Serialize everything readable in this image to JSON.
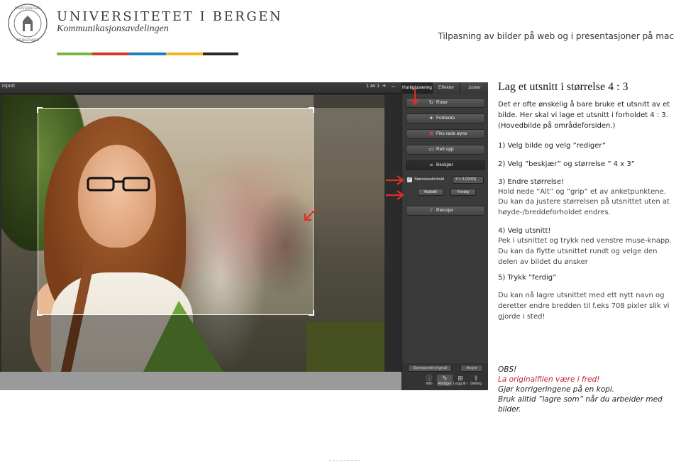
{
  "header": {
    "university": "UNIVERSITETET I BERGEN",
    "department": "Kommunikasjonsavdelingen",
    "title": "Tilpasning av bilder på web og i presentasjoner på mac",
    "stripe_colors": [
      "#7cb342",
      "#d23a2c",
      "#1e7fbf",
      "#f2b51c",
      "#2a2a2a"
    ]
  },
  "screenshot": {
    "toolbar": {
      "left_label": "mport",
      "page_indicator": "1 av 1",
      "plus": "+",
      "minus": "–"
    },
    "tabs": [
      "Hurtigjustering",
      "Effekter",
      "Juster"
    ],
    "buttons": {
      "roter": "Roter",
      "forbedre": "Forbedre",
      "fiks": "Fiks røde øyne",
      "rett": "Rett opp",
      "beskjaer": "Beskjær",
      "retusjer": "Retusjer"
    },
    "size_ratio_label": "Størrelsesforhold",
    "size_ratio_value": "4 × 3 (DVD)",
    "nullstill": "Nullstill",
    "ferdig": "Ferdig",
    "gjenopprett": "Gjenopprett original",
    "angre": "Angre",
    "tools": [
      "Info",
      "Rediger",
      "Legg til i",
      "Deling"
    ]
  },
  "instructions": {
    "title": "Lag et utsnitt i størrelse 4 : 3",
    "intro": "Det er ofte ønskelig  å bare bruke et utsnitt av et bilde.  Her skal vi lage et utsnitt i forholdet 4 : 3.  (Hovedbilde på områdeforsiden.)",
    "step1": "1) Velg bilde og velg ”rediger”",
    "step2": "2) Velg ”beskjær” og størrelse  ” 4 x 3”",
    "step3_title": "3) Endre størrelse!",
    "step3_line1": "Hold nede ”Alt” og ”grip” et av anketpunktene.",
    "step3_line2": "Du kan da justere størrelsen på utsnittet uten at høyde-/breddeforholdet endres.",
    "step4_title": "4) Velg utsnitt!",
    "step4_text": "Pek i utsnittet og trykk ned venstre muse-knapp. Du kan da flytte utsnittet rundt og velge den delen av bildet du ønsker",
    "step5": "5) Trykk ”ferdig”",
    "closing": "Du kan nå lagre utsnittet med ett nytt navn og deretter endre bredden til f.eks 708 pixler slik vi gjorde i sted!"
  },
  "note": {
    "obs": "OBS!",
    "line1": "La originalfilen være i fred!",
    "line2": "Gjør korrigeringene på en kopi.",
    "line3": "Bruk alltid ”lagre som” når du arbeider med bilder."
  },
  "colors": {
    "arrow_red": "#d8302a",
    "note_red": "#c21f2f"
  }
}
